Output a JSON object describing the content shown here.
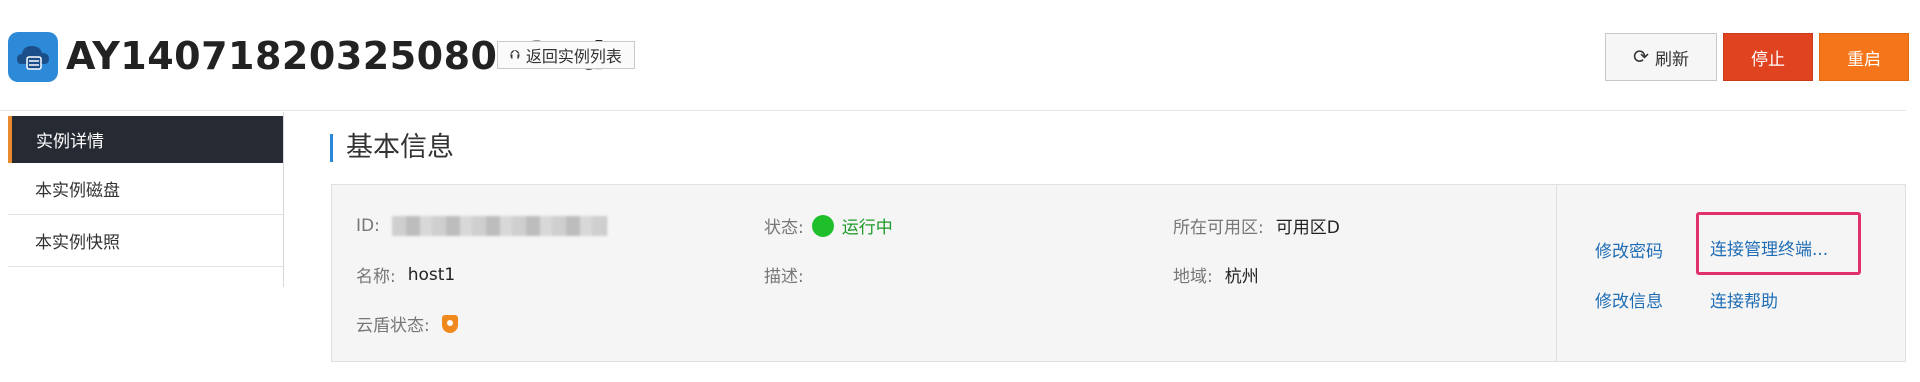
{
  "header": {
    "instance_id": "AY14071820325080124d",
    "back_label": "返回实例列表",
    "refresh_label": "刷新",
    "stop_label": "停止",
    "restart_label": "重启",
    "icons": {
      "app": "cloud-server-icon",
      "back": "upload-arrow-icon",
      "refresh": "refresh-icon"
    }
  },
  "sidebar": {
    "items": [
      {
        "label": "实例详情",
        "active": true
      },
      {
        "label": "本实例磁盘",
        "active": false
      },
      {
        "label": "本实例快照",
        "active": false
      }
    ]
  },
  "section": {
    "title": "基本信息"
  },
  "info": {
    "id_label": "ID:",
    "name_label": "名称:",
    "name_value": "host1",
    "shield_label": "云盾状态:",
    "status_label": "状态:",
    "status_value": "运行中",
    "desc_label": "描述:",
    "zone_label": "所在可用区:",
    "zone_value": "可用区D",
    "region_label": "地域:",
    "region_value": "杭州"
  },
  "actions": {
    "change_password": "修改密码",
    "connect_terminal": "连接管理终端...",
    "change_info": "修改信息",
    "connect_help": "连接帮助"
  },
  "colors": {
    "accent": "#2b88d8",
    "stop": "#e0431f",
    "restart": "#f5761a",
    "running": "#1fbf2c",
    "link": "#1f6db5",
    "highlight": "#e0306e",
    "sidebar_active": "#252a33"
  }
}
